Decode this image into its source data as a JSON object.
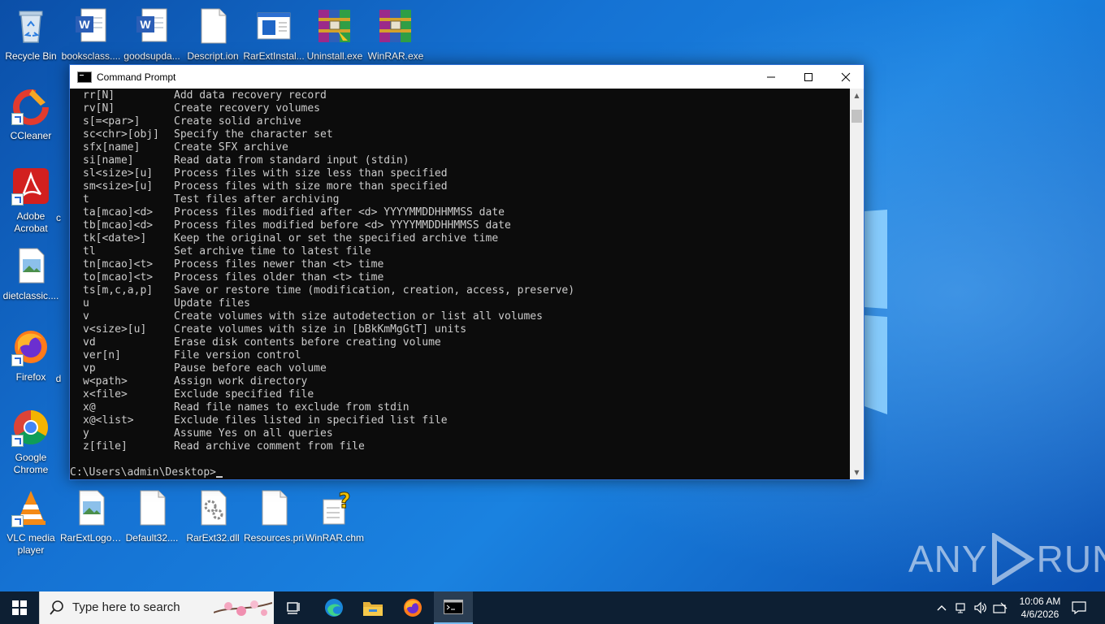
{
  "desktop": {
    "icons": [
      {
        "label": "Recycle Bin",
        "icon": "recycle-bin-icon"
      },
      {
        "label": "booksclass....",
        "icon": "word-document-icon"
      },
      {
        "label": "goodsupda...",
        "icon": "word-document-icon"
      },
      {
        "label": "Descript.ion",
        "icon": "blank-file-icon"
      },
      {
        "label": "RarExtInstal...",
        "icon": "installer-window-icon"
      },
      {
        "label": "Uninstall.exe",
        "icon": "winrar-uninstall-icon"
      },
      {
        "label": "WinRAR.exe",
        "icon": "winrar-icon"
      },
      {
        "label": "CCleaner",
        "icon": "ccleaner-icon"
      },
      {
        "label": "Adobe Acrobat",
        "icon": "acrobat-icon"
      },
      {
        "label": "dietclassic....",
        "icon": "image-file-icon"
      },
      {
        "label": "Firefox",
        "icon": "firefox-icon"
      },
      {
        "label": "Google Chrome",
        "icon": "chrome-icon"
      },
      {
        "label": "VLC media player",
        "icon": "vlc-icon"
      },
      {
        "label": "RarExtLogo....",
        "icon": "image-file-icon"
      },
      {
        "label": "Default32....",
        "icon": "blank-file-icon"
      },
      {
        "label": "RarExt32.dll",
        "icon": "dll-gear-file-icon"
      },
      {
        "label": "Resources.pri",
        "icon": "blank-file-icon"
      },
      {
        "label": "WinRAR.chm",
        "icon": "help-file-icon"
      }
    ],
    "partial_labels": [
      "c",
      "d",
      "d",
      "c"
    ]
  },
  "cmd": {
    "title": "Command Prompt",
    "lines": [
      [
        "rr[N]",
        "Add data recovery record"
      ],
      [
        "rv[N]",
        "Create recovery volumes"
      ],
      [
        "s[=<par>]",
        "Create solid archive"
      ],
      [
        "sc<chr>[obj]",
        "Specify the character set"
      ],
      [
        "sfx[name]",
        "Create SFX archive"
      ],
      [
        "si[name]",
        "Read data from standard input (stdin)"
      ],
      [
        "sl<size>[u]",
        "Process files with size less than specified"
      ],
      [
        "sm<size>[u]",
        "Process files with size more than specified"
      ],
      [
        "t",
        "Test files after archiving"
      ],
      [
        "ta[mcao]<d>",
        "Process files modified after <d> YYYYMMDDHHMMSS date"
      ],
      [
        "tb[mcao]<d>",
        "Process files modified before <d> YYYYMMDDHHMMSS date"
      ],
      [
        "tk[<date>]",
        "Keep the original or set the specified archive time"
      ],
      [
        "tl",
        "Set archive time to latest file"
      ],
      [
        "tn[mcao]<t>",
        "Process files newer than <t> time"
      ],
      [
        "to[mcao]<t>",
        "Process files older than <t> time"
      ],
      [
        "ts[m,c,a,p]",
        "Save or restore time (modification, creation, access, preserve)"
      ],
      [
        "u",
        "Update files"
      ],
      [
        "v",
        "Create volumes with size autodetection or list all volumes"
      ],
      [
        "v<size>[u]",
        "Create volumes with size in [bBkKmMgGtT] units"
      ],
      [
        "vd",
        "Erase disk contents before creating volume"
      ],
      [
        "ver[n]",
        "File version control"
      ],
      [
        "vp",
        "Pause before each volume"
      ],
      [
        "w<path>",
        "Assign work directory"
      ],
      [
        "x<file>",
        "Exclude specified file"
      ],
      [
        "x@",
        "Read file names to exclude from stdin"
      ],
      [
        "x@<list>",
        "Exclude files listed in specified list file"
      ],
      [
        "y",
        "Assume Yes on all queries"
      ],
      [
        "z[file]",
        "Read archive comment from file"
      ]
    ],
    "prompt": "C:\\Users\\admin\\Desktop>"
  },
  "taskbar": {
    "search_placeholder": "Type here to search",
    "time": "10:06 AM",
    "date": "4/6/2026"
  },
  "watermark": {
    "left": "ANY",
    "right": "RUN"
  }
}
